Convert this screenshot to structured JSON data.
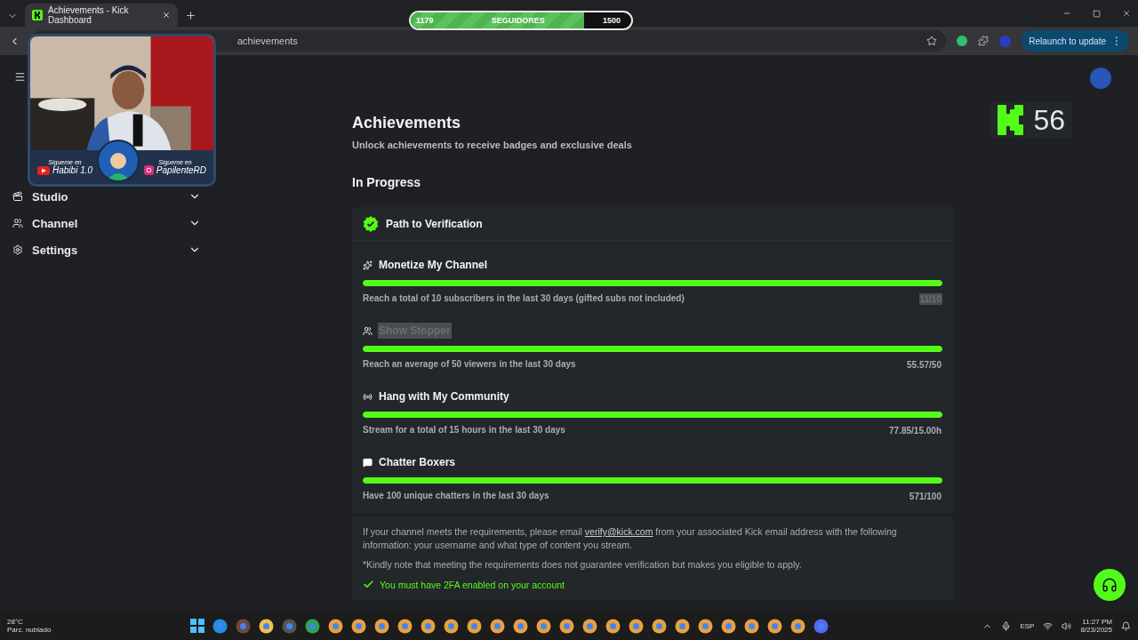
{
  "browser": {
    "tab_title": "Achievements - Kick Dashboard",
    "address": "achievements",
    "relaunch_label": "Relaunch to update",
    "relaunch_menu": "⋮"
  },
  "overlay": {
    "followers": {
      "current": "1179",
      "label": "SEGUIDORES",
      "goal": "1500",
      "level": 0.786
    },
    "socials": [
      {
        "kind": "youtube",
        "caption": "Sigueme en",
        "handle": "Habibi 1.0"
      },
      {
        "kind": "instagram",
        "caption": "Sigueme en",
        "handle": "PapilenteRD"
      }
    ],
    "kick_counter": "56"
  },
  "sidebar": {
    "items": [
      {
        "kind": "studio",
        "label": "Studio"
      },
      {
        "kind": "channel",
        "label": "Channel"
      },
      {
        "kind": "settings",
        "label": "Settings"
      }
    ]
  },
  "page": {
    "title": "Achievements",
    "subtitle": "Unlock achievements to receive badges and exclusive deals",
    "section": "In Progress",
    "card": {
      "title": "Path to Verification",
      "items": [
        {
          "kind": "sparkle",
          "title": "Monetize My Channel",
          "title_highlighted": false,
          "description": "Reach a total of 10 subscribers in the last 30 days (gifted subs not included)",
          "progress": "11/10",
          "progress_highlighted": true,
          "level": 1
        },
        {
          "kind": "people",
          "title": "Show Stopper",
          "title_highlighted": true,
          "description": "Reach an average of 50 viewers in the last 30 days",
          "progress": "55.57/50",
          "progress_highlighted": false,
          "level": 1
        },
        {
          "kind": "broadcast",
          "title": "Hang with My Community",
          "title_highlighted": false,
          "description": "Stream for a total of 15 hours in the last 30 days",
          "progress": "77.85/15.00h",
          "progress_highlighted": false,
          "level": 1
        },
        {
          "kind": "chat",
          "title": "Chatter Boxers",
          "title_highlighted": false,
          "description": "Have 100 unique chatters in the last 30 days",
          "progress": "571/100",
          "progress_highlighted": false,
          "level": 1
        }
      ]
    },
    "info": {
      "text_before": "If your channel meets the requirements, please email",
      "email": "verify@kick.com",
      "text_after": "from your associated Kick email address with the following information: your username and what type of content you stream.",
      "note": "*Kindly note that meeting the requirements does not guarantee verification but makes you eligible to apply.",
      "requirements": [
        {
          "label": "You must have 2FA enabled on your account",
          "checked": true
        }
      ]
    }
  },
  "taskbar": {
    "temperature": "28°C",
    "weather": "Parc. nublado",
    "language": "ESP",
    "time": "11:27 PM",
    "date": "8/23/2025"
  }
}
